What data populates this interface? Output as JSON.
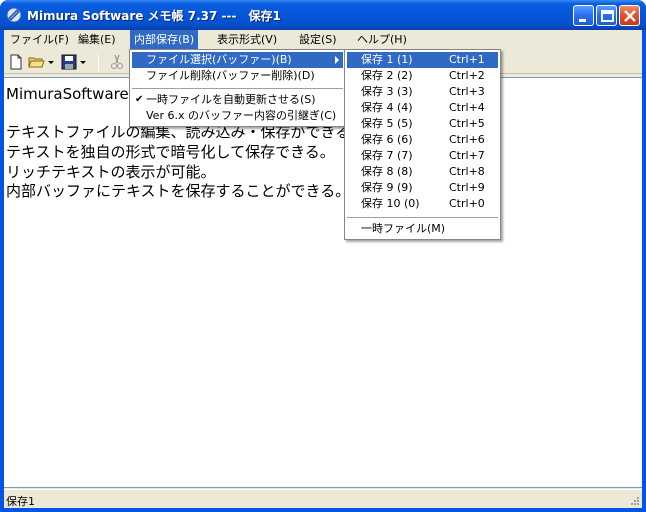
{
  "window": {
    "title": "Mimura Software メモ帳 7.37 ---　保存1"
  },
  "menubar": {
    "items": [
      {
        "label": "ファイル(F)"
      },
      {
        "label": "編集(E)"
      },
      {
        "label": "内部保存(B)"
      },
      {
        "label": "表示形式(V)"
      },
      {
        "label": "設定(S)"
      },
      {
        "label": "ヘルプ(H)"
      }
    ]
  },
  "dropdown_main": {
    "items": [
      {
        "label": "ファイル選択(バッファー)(B)"
      },
      {
        "label": "ファイル削除(バッファー削除)(D)"
      },
      {
        "label": "一時ファイルを自動更新させる(S)",
        "checked": true
      },
      {
        "label": "Ver 6.x のバッファー内容の引継ぎ(C)"
      }
    ]
  },
  "dropdown_sub": {
    "items": [
      {
        "label": "保存 1 (1)",
        "shortcut": "Ctrl+1"
      },
      {
        "label": "保存 2 (2)",
        "shortcut": "Ctrl+2"
      },
      {
        "label": "保存 3 (3)",
        "shortcut": "Ctrl+3"
      },
      {
        "label": "保存 4 (4)",
        "shortcut": "Ctrl+4"
      },
      {
        "label": "保存 5 (5)",
        "shortcut": "Ctrl+5"
      },
      {
        "label": "保存 6 (6)",
        "shortcut": "Ctrl+6"
      },
      {
        "label": "保存 7 (7)",
        "shortcut": "Ctrl+7"
      },
      {
        "label": "保存 8 (8)",
        "shortcut": "Ctrl+8"
      },
      {
        "label": "保存 9 (9)",
        "shortcut": "Ctrl+9"
      },
      {
        "label": "保存 10 (0)",
        "shortcut": "Ctrl+0"
      },
      {
        "label": "一時ファイル(M)"
      }
    ]
  },
  "editor": {
    "lines": [
      "MimuraSoftwareメ",
      "",
      "テキストファイルの編集、読み込み・保存ができる。",
      "テキストを独自の形式で暗号化して保存できる。",
      "リッチテキストの表示が可能。",
      "内部バッファにテキストを保存することができる。"
    ]
  },
  "statusbar": {
    "text": "保存1"
  },
  "colors": {
    "highlight": "#316ac5",
    "titlebar": "#0451d0",
    "chrome": "#ece9d8"
  }
}
